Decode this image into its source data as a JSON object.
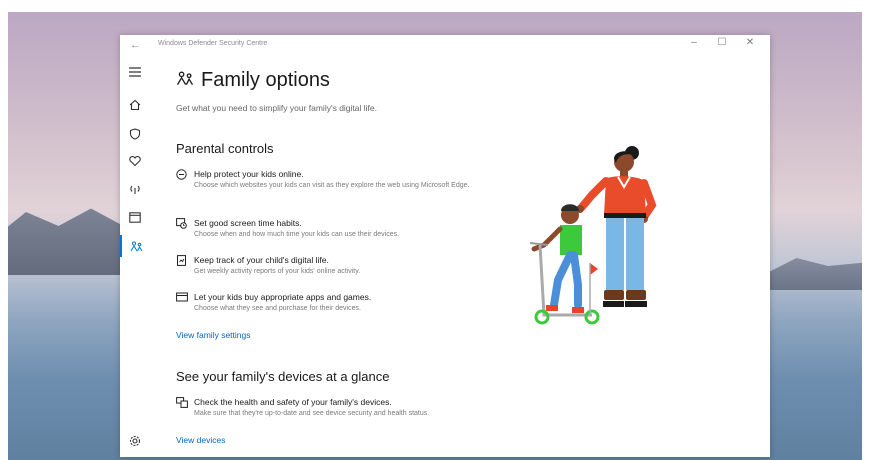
{
  "window": {
    "title": "Windows Defender Security Centre",
    "back_icon": "back-arrow-icon",
    "controls": [
      "minimize-icon",
      "maximize-icon",
      "close-icon"
    ]
  },
  "nav": {
    "items": [
      {
        "name": "hamburger-menu-icon"
      },
      {
        "name": "home-icon"
      },
      {
        "name": "shield-icon"
      },
      {
        "name": "heart-icon"
      },
      {
        "name": "wifi-antenna-icon"
      },
      {
        "name": "app-browser-icon"
      },
      {
        "name": "family-icon",
        "active": true
      }
    ],
    "settings_icon": "settings-gear-icon"
  },
  "page": {
    "title": "Family options",
    "subtitle": "Get what you need to simplify your family's digital life.",
    "parental": {
      "heading": "Parental controls",
      "items": [
        {
          "icon": "circle-minus-icon",
          "title": "Help protect your kids online.",
          "desc": "Choose which websites your kids can visit as they explore the web using Microsoft Edge."
        },
        {
          "icon": "screen-time-icon",
          "title": "Set good screen time habits.",
          "desc": "Choose when and how much time your kids can use their devices."
        },
        {
          "icon": "activity-report-icon",
          "title": "Keep track of your child's digital life.",
          "desc": "Get weekly activity reports of your kids' online activity."
        },
        {
          "icon": "card-icon",
          "title": "Let your kids buy appropriate apps and games.",
          "desc": "Choose what they see and purchase for their devices."
        }
      ],
      "link": "View family settings"
    },
    "devices": {
      "heading": "See your family's devices at a glance",
      "item": {
        "icon": "devices-icon",
        "title": "Check the health and safety of your family's devices.",
        "desc": "Make sure that they're up-to-date and see device security and health status."
      },
      "link": "View devices"
    }
  },
  "colors": {
    "accent": "#0078d7",
    "link": "#0067c0"
  }
}
